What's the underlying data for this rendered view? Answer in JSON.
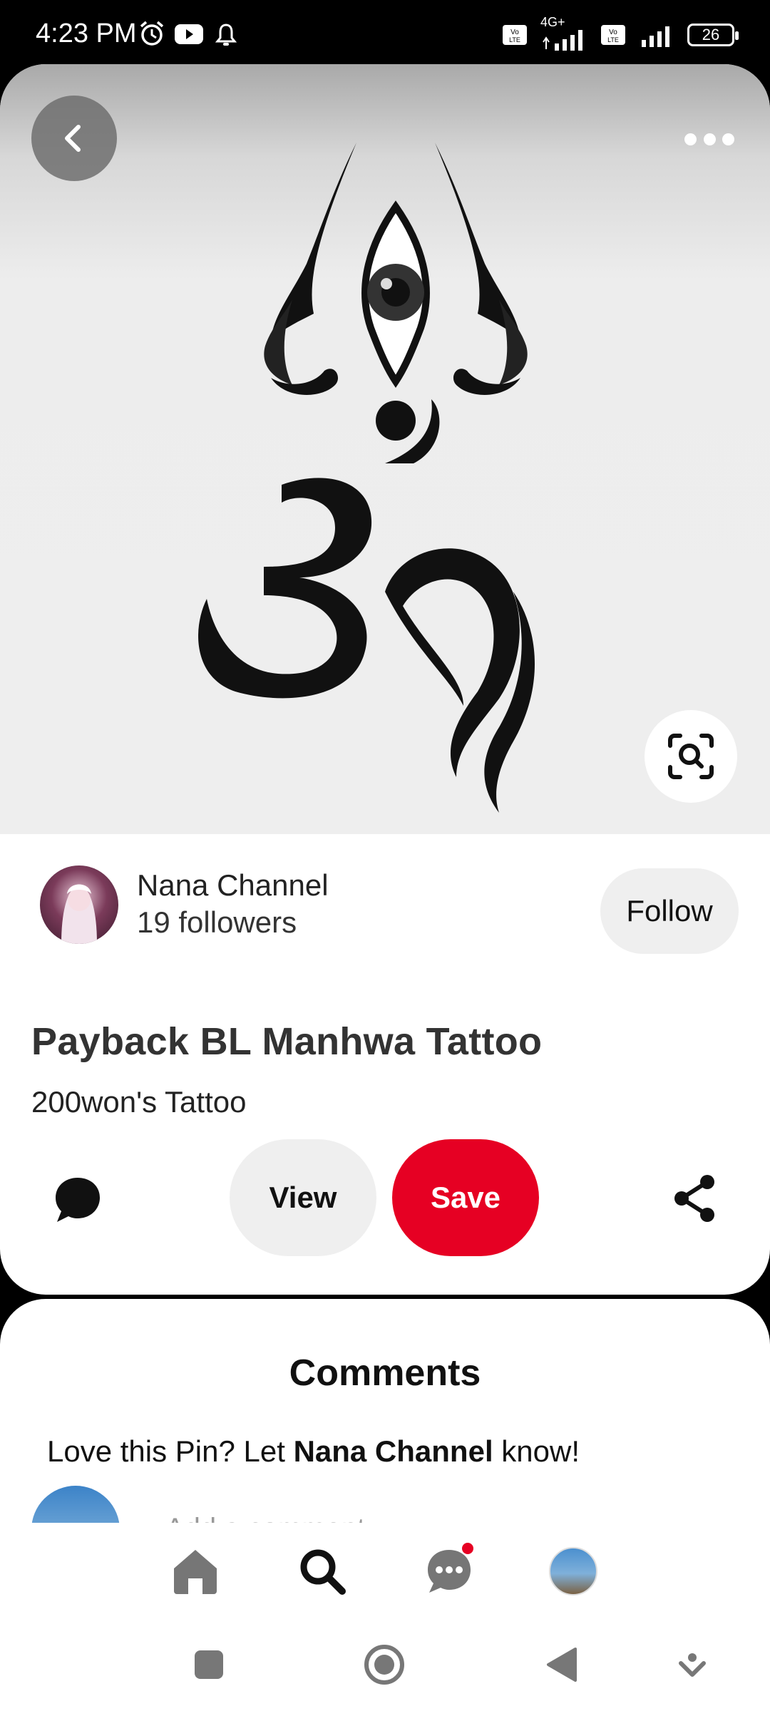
{
  "status_bar": {
    "time": "4:23 PM",
    "battery": "26",
    "network_label": "4G+"
  },
  "pin": {
    "image_alt": "Om trishul third-eye tattoo sketch",
    "creator": {
      "name": "Nana Channel",
      "followers": "19 followers"
    },
    "follow_label": "Follow",
    "title": "Payback BL Manhwa Tattoo",
    "subtitle": "200won's Tattoo",
    "actions": {
      "view_label": "View",
      "save_label": "Save"
    },
    "colors": {
      "save": "#e60023",
      "pill": "#efefef"
    }
  },
  "comments": {
    "title": "Comments",
    "prompt_prefix": "Love this Pin? Let ",
    "prompt_name": "Nana Channel",
    "prompt_suffix": " know!",
    "add_placeholder": "Add a comment"
  },
  "bottom_nav": {
    "items": [
      "home-icon",
      "search-icon",
      "messages-icon",
      "profile-avatar"
    ]
  }
}
